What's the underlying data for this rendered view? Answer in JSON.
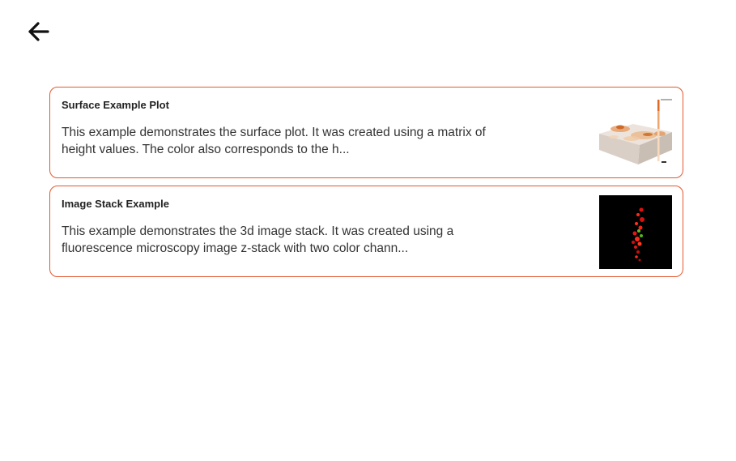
{
  "header": {
    "back_icon": "arrow-left-icon"
  },
  "cards": [
    {
      "title": "Surface Example Plot",
      "description": "This example demonstrates the surface plot. It was created using a matrix of height values. The color also corresponds to the h...",
      "thumbnail": "surface-plot-thumbnail"
    },
    {
      "title": "Image Stack Example",
      "description": "This example demonstrates the 3d image stack. It was created using a fluorescence microscopy image z-stack with two color chann...",
      "thumbnail": "image-stack-thumbnail"
    }
  ],
  "colors": {
    "accent": "#e4572e",
    "text": "#222222"
  }
}
